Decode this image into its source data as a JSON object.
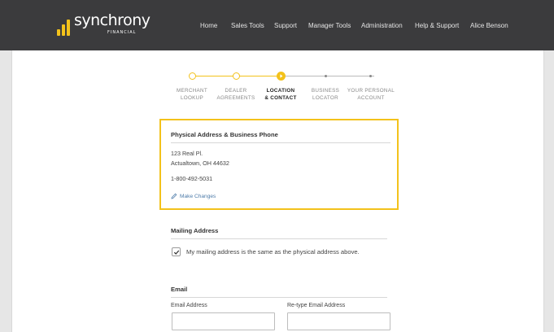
{
  "header": {
    "logo_text": "synchrony",
    "logo_sub": "FINANCIAL",
    "logo_colors": [
      "#f3c21b",
      "#f3c21b",
      "#f3c21b"
    ],
    "nav": [
      {
        "label": "Home"
      },
      {
        "label": "Sales Tools"
      },
      {
        "label": "Support"
      },
      {
        "label": "Manager Tools"
      },
      {
        "label": "Administration"
      },
      {
        "label": "Help & Support"
      },
      {
        "label": "Alice Benson"
      }
    ]
  },
  "stepper": {
    "steps": [
      {
        "line1": "MERCHANT",
        "line2": "LOOKUP",
        "state": "complete"
      },
      {
        "line1": "DEALER",
        "line2": "AGREEMENTS",
        "state": "complete"
      },
      {
        "line1": "LOCATION",
        "line2": "& CONTACT",
        "state": "current"
      },
      {
        "line1": "BUSINESS",
        "line2": "LOCATOR",
        "state": "upcoming"
      },
      {
        "line1": "YOUR PERSONAL",
        "line2": "ACCOUNT",
        "state": "upcoming"
      }
    ],
    "accent_color": "#f3c21b"
  },
  "physical": {
    "title": "Physical Address & Business Phone",
    "address_line1": "123 Real Pl.",
    "address_line2": "Actualtown, OH 44632",
    "phone": "1-800-492-5031",
    "edit_link": "Make Changes"
  },
  "mailing": {
    "title": "Mailing Address",
    "checkbox_label": "My mailing address is the same as the physical address above.",
    "checked": true
  },
  "email": {
    "title": "Email",
    "field1_label": "Email Address",
    "field1_value": "",
    "field2_label": "Re-type Email Address",
    "field2_value": ""
  }
}
